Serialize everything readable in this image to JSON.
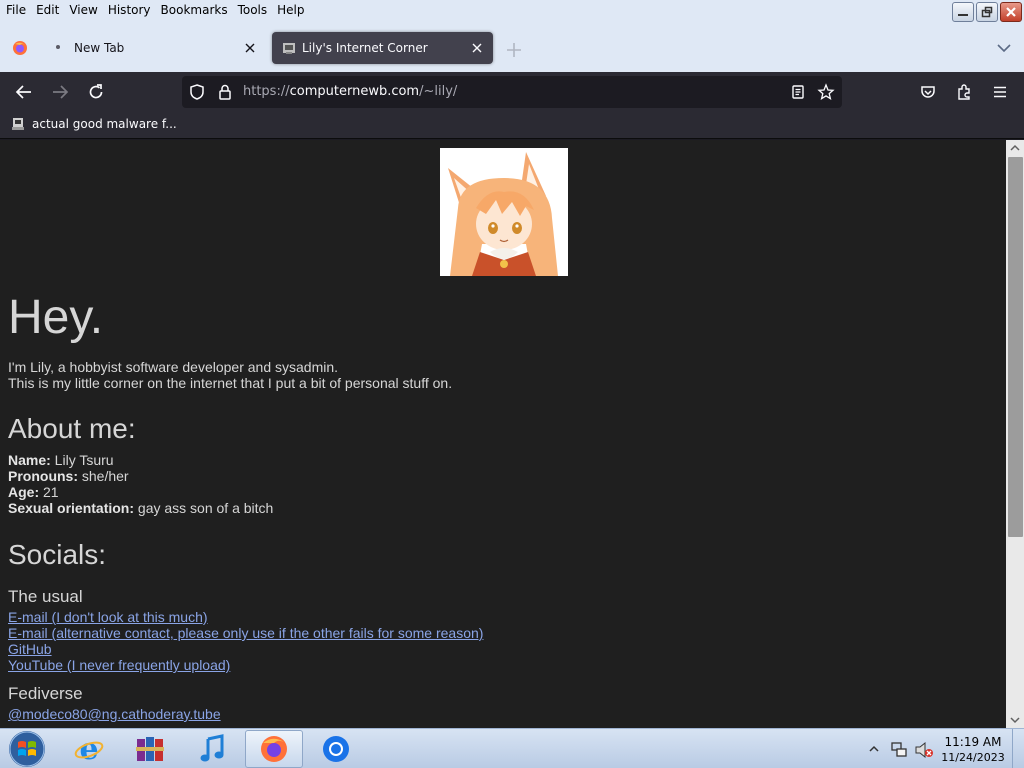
{
  "menubar": {
    "items": [
      "File",
      "Edit",
      "View",
      "History",
      "Bookmarks",
      "Tools",
      "Help"
    ]
  },
  "tabs": [
    {
      "label": "New Tab",
      "active": false
    },
    {
      "label": "Lily's Internet Corner",
      "active": true
    }
  ],
  "urlbar": {
    "scheme": "https://",
    "host": "computernewb.com",
    "path": "/~lily/"
  },
  "bookmarks": [
    {
      "label": "actual good malware f..."
    }
  ],
  "page": {
    "heading": "Hey.",
    "intro_line1": "I'm Lily, a hobbyist software developer and sysadmin.",
    "intro_line2": "This is my little corner on the internet that I put a bit of personal stuff on.",
    "about_heading": "About me:",
    "about": [
      {
        "key": "Name:",
        "value": " Lily Tsuru"
      },
      {
        "key": "Pronouns:",
        "value": " she/her"
      },
      {
        "key": "Age:",
        "value": " 21"
      },
      {
        "key": "Sexual orientation:",
        "value": " gay ass son of a bitch"
      }
    ],
    "socials_heading": "Socials:",
    "usual_heading": "The usual",
    "usual_links": [
      "E-mail (I don't look at this much)",
      "E-mail (alternative contact, please only use if the other fails for some reason)",
      "GitHub",
      "YouTube (I never frequently upload)"
    ],
    "fediverse_heading": "Fediverse",
    "fediverse_links": [
      "@modeco80@ng.cathoderay.tube"
    ]
  },
  "taskbar": {
    "time": "11:19 AM",
    "date": "11/24/2023"
  },
  "colors": {
    "link": "#8aa4e6",
    "content_bg": "#1f1f1f",
    "toolbar_bg": "#2b2a33"
  }
}
